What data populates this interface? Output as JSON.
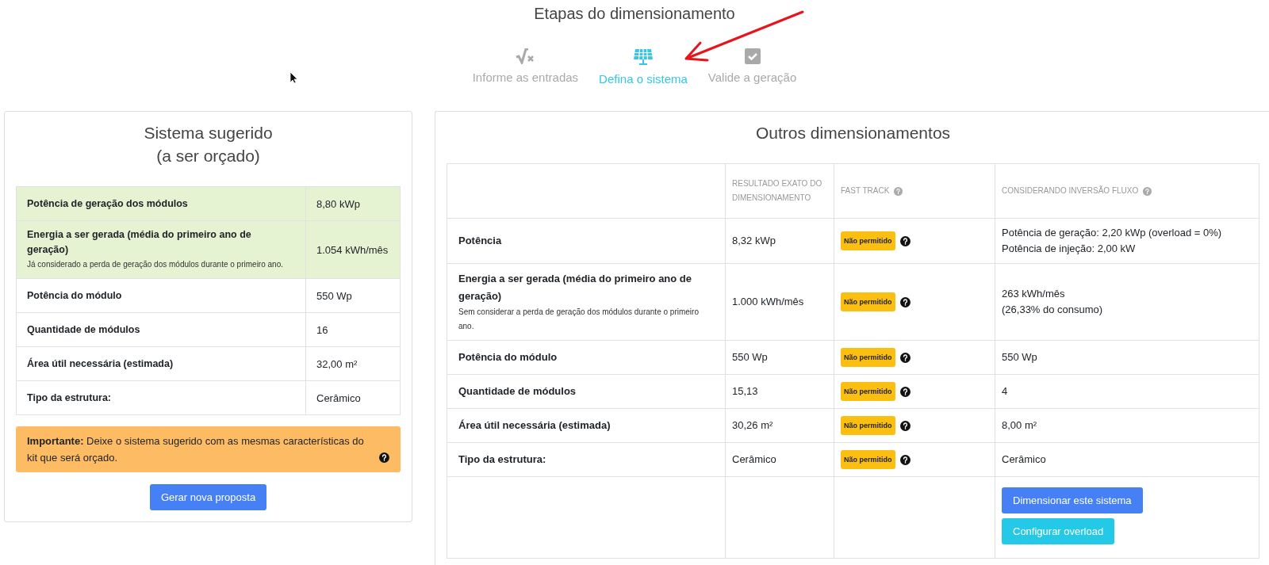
{
  "header": {
    "title": "Etapas do dimensionamento"
  },
  "steps": [
    {
      "kind": "formula",
      "label": "Informe as entradas",
      "selected": false
    },
    {
      "kind": "solar-panel",
      "label": "Defina o sistema",
      "selected": true
    },
    {
      "kind": "check",
      "label": "Valide a geração",
      "selected": false
    }
  ],
  "suggested": {
    "title_lines": [
      "Sistema sugerido",
      "(a ser orçado)"
    ],
    "rows": [
      {
        "label": "Potência de geração dos módulos",
        "value": "8,80 kWp",
        "highlighted": true
      },
      {
        "label": "Energia a ser gerada (média do primeiro ano de geração)",
        "note": "Já considerado a perda de geração dos módulos durante o primeiro ano.",
        "value": "1.054 kWh/mês",
        "highlighted": true
      },
      {
        "label": "Potência do módulo",
        "value": "550 Wp",
        "highlighted": false
      },
      {
        "label": "Quantidade de módulos",
        "value": "16",
        "highlighted": false
      },
      {
        "label": "Área útil necessária (estimada)",
        "value": "32,00 m²",
        "highlighted": false
      },
      {
        "label": "Tipo da estrutura:",
        "value": "Cerâmico",
        "highlighted": false
      }
    ],
    "alert": {
      "text": "**Importante:** Deixe o sistema sugerido com as mesmas características do kit que será orçado.",
      "help": true
    },
    "button": "Gerar nova proposta"
  },
  "others": {
    "title": "Outros dimensionamentos",
    "columns": [
      {
        "label": "RESULTADO EXATO DO DIMENSIONAMENTO",
        "help": false
      },
      {
        "label": "FAST TRACK",
        "help": true
      },
      {
        "label": "CONSIDERANDO INVERSÃO FLUXO",
        "help": true
      }
    ],
    "rows": [
      {
        "label": "Potência",
        "exact": "8,32 kWp",
        "fast_track": "Não permitido",
        "inversion": [
          "Potência de geração: 2,20 kWp (overload = 0%)",
          "Potência de injeção: 2,00 kW"
        ]
      },
      {
        "label": "Energia a ser gerada (média do primeiro ano de geração)",
        "note": "Sem considerar a perda de geração dos módulos durante o primeiro ano.",
        "exact": "1.000 kWh/mês",
        "fast_track": "Não permitido",
        "inversion": [
          "263 kWh/mês",
          "(26,33% do consumo)"
        ]
      },
      {
        "label": "Potência do módulo",
        "exact": "550 Wp",
        "fast_track": "Não permitido",
        "inversion": [
          "550 Wp"
        ]
      },
      {
        "label": "Quantidade de módulos",
        "exact": "15,13",
        "fast_track": "Não permitido",
        "inversion": [
          "4"
        ]
      },
      {
        "label": "Área útil necessária (estimada)",
        "exact": "30,26 m²",
        "fast_track": "Não permitido",
        "inversion": [
          "8,00 m²"
        ]
      },
      {
        "label": "Tipo da estrutura:",
        "exact": "Cerâmico",
        "fast_track": "Não permitido",
        "inversion": [
          "Cerâmico"
        ]
      }
    ],
    "actions": [
      {
        "kind": "primary",
        "label": "Dimensionar este sistema"
      },
      {
        "kind": "info",
        "label": "Configurar overload"
      }
    ]
  }
}
